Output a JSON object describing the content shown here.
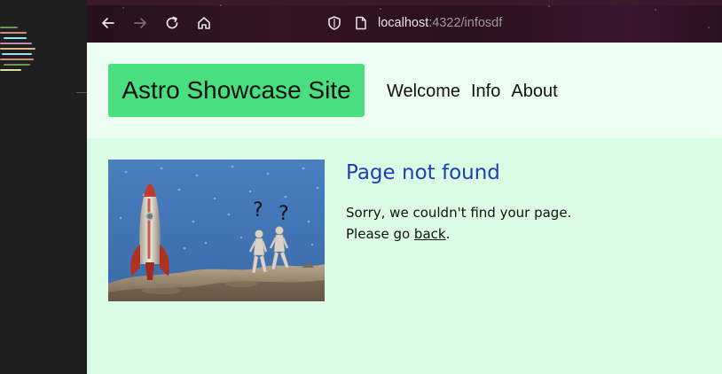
{
  "browser": {
    "url_host": "localhost",
    "url_rest": ":4322/infosdf"
  },
  "site": {
    "brand": "Astro Showcase Site",
    "nav": [
      "Welcome",
      "Info",
      "About"
    ]
  },
  "not_found": {
    "title": "Page not found",
    "line1": "Sorry, we couldn't find your page.",
    "line2_prefix": "Please go ",
    "back_link": "back",
    "line2_suffix": "."
  },
  "image": {
    "question_marks": [
      "?",
      "?"
    ]
  },
  "colors": {
    "header_bg": "#ecfdf1",
    "page_bg": "#dcfbe5",
    "brand_bg": "#4ade80",
    "title_color": "#1e40af"
  },
  "icons": [
    "back-arrow-icon",
    "forward-arrow-icon",
    "reload-icon",
    "home-icon",
    "shield-icon",
    "page-icon"
  ]
}
